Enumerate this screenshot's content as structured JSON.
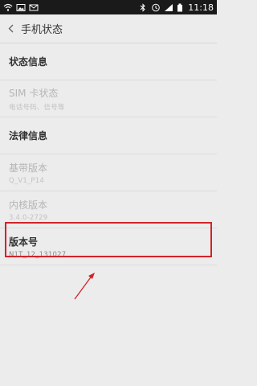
{
  "status_bar": {
    "time": "11:18",
    "icons": [
      "wifi-icon",
      "image-icon",
      "email-icon",
      "bluetooth-icon",
      "alarm-icon",
      "signal-icon",
      "battery-icon"
    ]
  },
  "header": {
    "title": "手机状态",
    "back_icon": "chevron-left-icon"
  },
  "list": {
    "status_info": {
      "label": "状态信息"
    },
    "sim_status": {
      "label": "SIM 卡状态",
      "sub": "电话号码、信号等"
    },
    "legal_info": {
      "label": "法律信息"
    },
    "baseband": {
      "label": "基带版本",
      "sub": "Q_V1_P14"
    },
    "kernel": {
      "label": "内核版本",
      "sub": "3.4.0-2729"
    },
    "build": {
      "label": "版本号",
      "sub": "N1T_12_131027"
    }
  },
  "colors": {
    "highlight": "#d2232a",
    "background": "#ececec",
    "status_bar": "#1a1a1a"
  }
}
